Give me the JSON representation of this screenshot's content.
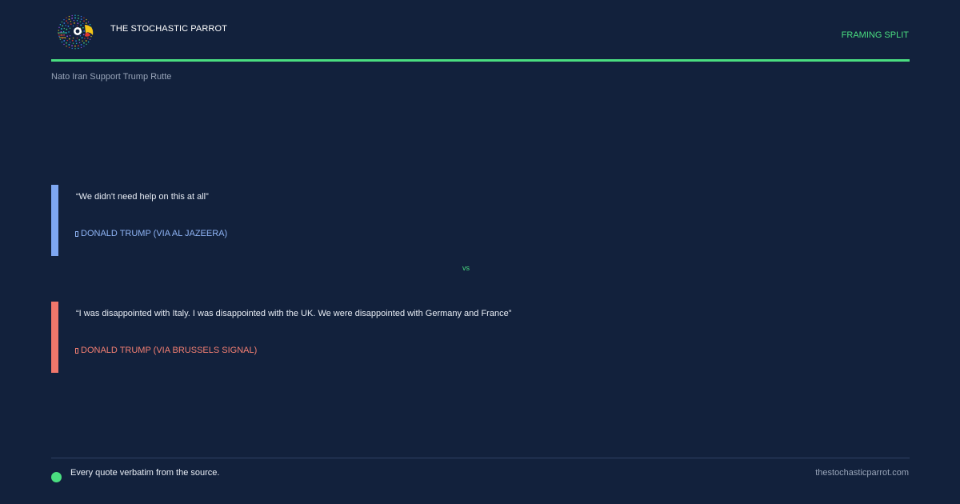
{
  "header": {
    "brand": "THE STOCHASTIC PARROT",
    "tag": "FRAMING SPLIT",
    "logo_icon": "parrot-logo-icon",
    "accent_color": "#4ade80"
  },
  "topic": "Nato Iran Support Trump Rutte",
  "quotes": [
    {
      "text": "“We didn't need help on this at all”",
      "source": "DONALD TRUMP (VIA AL JAZEERA)",
      "color": "#7ea7f2"
    },
    {
      "text": "“I was disappointed with Italy. I was disappointed with the UK. We were disappointed with Germany and France”",
      "source": "DONALD TRUMP (VIA BRUSSELS SIGNAL)",
      "color": "#f0776b"
    }
  ],
  "vs_label": "vs",
  "footer": {
    "note": "Every quote verbatim from the source.",
    "site": "thestochasticparrot.com"
  }
}
